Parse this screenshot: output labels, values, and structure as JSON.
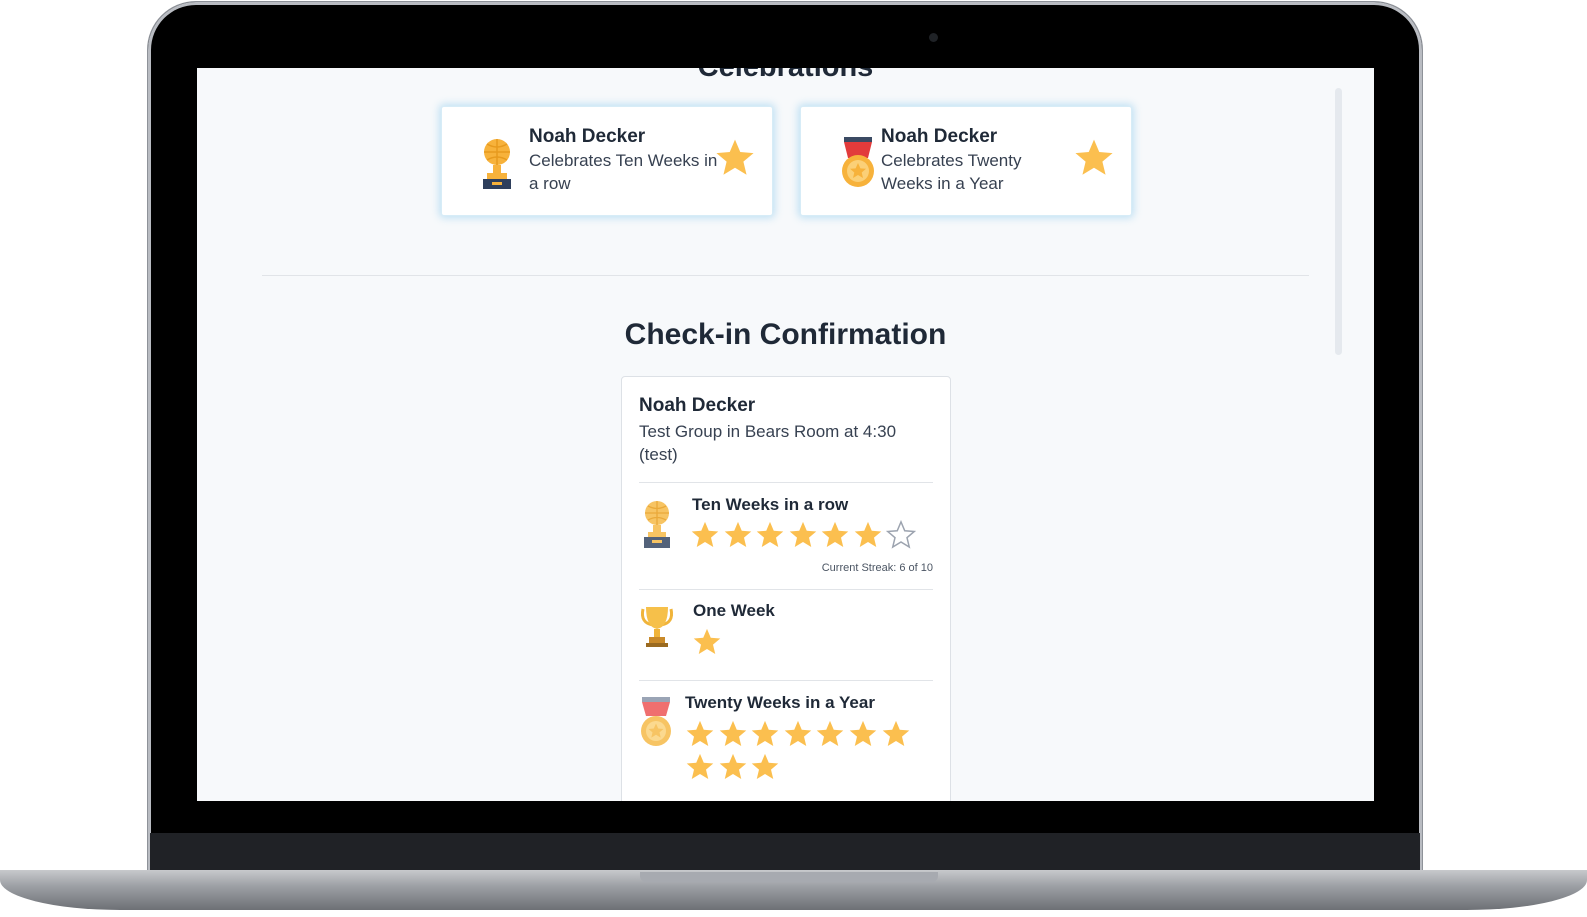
{
  "colors": {
    "star_fill": "#fbbf4f",
    "star_empty_stroke": "#9ca3af",
    "screen_bg": "#f7f9fb",
    "text_dark": "#1f2937"
  },
  "celebrations": {
    "section_title": "Celebrations",
    "cards": [
      {
        "name": "Noah Decker",
        "description": "Celebrates Ten Weeks in a row",
        "icon": "trophy-globe-icon",
        "badge_icon": "star-icon"
      },
      {
        "name": "Noah Decker",
        "description": "Celebrates Twenty Weeks in a Year",
        "icon": "medal-icon",
        "badge_icon": "star-icon"
      }
    ]
  },
  "checkin": {
    "title": "Check-in Confirmation",
    "person_name": "Noah Decker",
    "group_info": "Test Group in Bears Room at 4:30 (test)",
    "achievements": [
      {
        "title": "Ten Weeks in a row",
        "icon": "trophy-globe-icon",
        "filled": 6,
        "total": 7,
        "streak_label": "Current Streak: 6 of 10"
      },
      {
        "title": "One Week",
        "icon": "trophy-cup-icon",
        "filled": 1,
        "total": 1
      },
      {
        "title": "Twenty Weeks in a Year",
        "icon": "medal-icon",
        "filled": 10,
        "total": 10
      }
    ]
  }
}
